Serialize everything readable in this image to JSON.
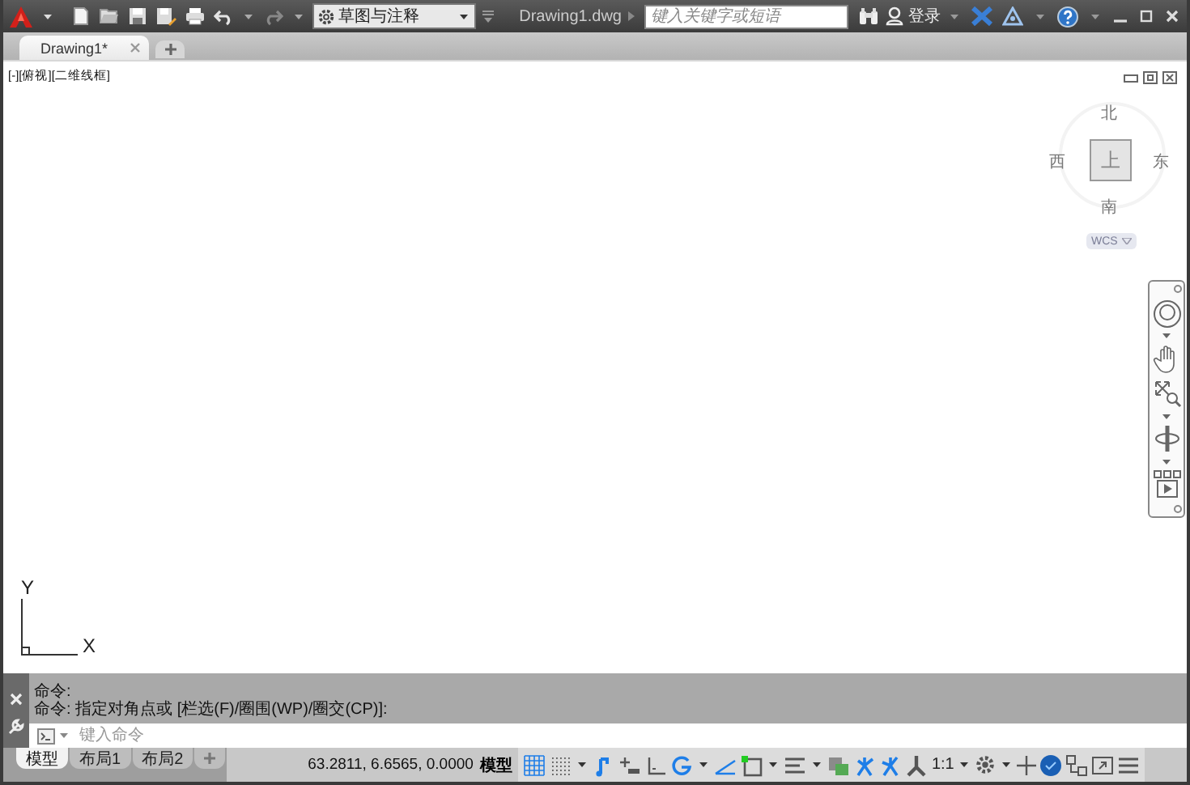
{
  "title_bar": {
    "workspace": "草图与注释",
    "file_name": "Drawing1.dwg",
    "search": {
      "placeholder": "键入关键字或短语"
    },
    "sign_in": "登录"
  },
  "document_tabs": [
    {
      "label": "Drawing1*",
      "selected": true
    }
  ],
  "viewport": {
    "controls": "[-][俯视][二维线框]",
    "viewcube": {
      "north": "北",
      "west": "西",
      "face": "上",
      "east": "东",
      "south": "南",
      "ucs": "WCS"
    },
    "ucs_axes": {
      "y": "Y",
      "x": "X"
    }
  },
  "command_line": {
    "history": [
      "命令:",
      "命令: 指定对角点或 [栏选(F)/圈围(WP)/圈交(CP)]:"
    ],
    "input": {
      "placeholder": "键入命令"
    }
  },
  "layout_tabs": [
    {
      "label": "模型",
      "selected": true
    },
    {
      "label": "布局1",
      "selected": false
    },
    {
      "label": "布局2",
      "selected": false
    }
  ],
  "status_bar": {
    "coordinates": "63.2811, 6.6565, 0.0000",
    "space": "模型",
    "scale": "1:1",
    "toggles": [
      {
        "kind": "grid",
        "on": true,
        "menu": false
      },
      {
        "kind": "snap",
        "on": false,
        "menu": true
      },
      {
        "kind": "infer",
        "on": true,
        "menu": false
      },
      {
        "kind": "dynamic",
        "on": false,
        "menu": false
      },
      {
        "kind": "ortho",
        "on": false,
        "menu": false
      },
      {
        "kind": "polar",
        "on": true,
        "menu": true
      },
      {
        "kind": "isodraft",
        "on": true,
        "menu": false
      },
      {
        "kind": "osnap",
        "on": false,
        "menu": true
      },
      {
        "kind": "lineweight",
        "on": false,
        "menu": true
      },
      {
        "kind": "transparency",
        "on": false,
        "menu": false
      },
      {
        "kind": "annovis",
        "on": true,
        "menu": false
      },
      {
        "kind": "autoscale",
        "on": true,
        "menu": false
      },
      {
        "kind": "annoscale",
        "on": false,
        "menu": false
      }
    ]
  }
}
